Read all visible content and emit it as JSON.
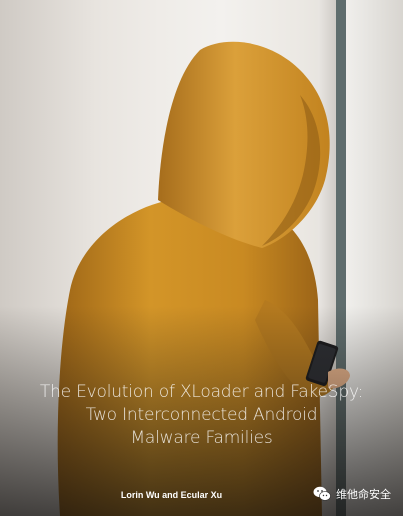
{
  "cover": {
    "title_lines": [
      "The Evolution of XLoader and FakeSpy:",
      "Two Interconnected Android",
      "Malware Families"
    ],
    "authors": "Lorin Wu and Ecular Xu"
  },
  "watermark": {
    "icon": "wechat-icon",
    "text": "维他命安全"
  },
  "colors": {
    "hoodie": "#d99a2b",
    "hoodie_shadow": "#a8701c",
    "background": "#ece9e4",
    "text": "#ffffff"
  }
}
